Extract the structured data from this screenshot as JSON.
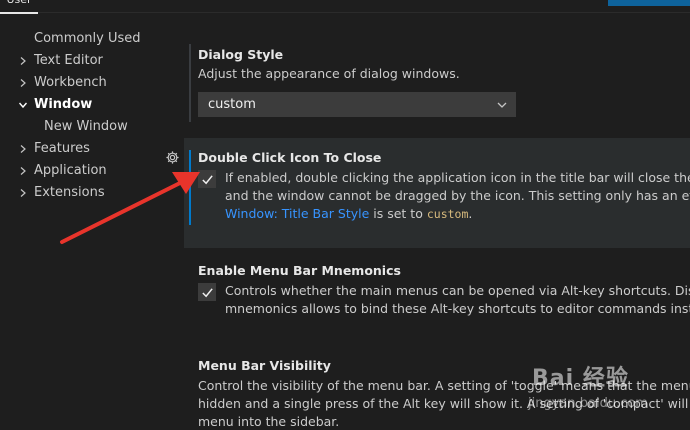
{
  "header": {
    "tab_label": "User"
  },
  "toc": {
    "items": [
      {
        "label": "Commonly Used",
        "expandable": false
      },
      {
        "label": "Text Editor",
        "expandable": true
      },
      {
        "label": "Workbench",
        "expandable": true
      },
      {
        "label": "Window",
        "expandable": true,
        "expanded": true,
        "active": true
      },
      {
        "label": "New Window",
        "expandable": false,
        "child": true
      },
      {
        "label": "Features",
        "expandable": true
      },
      {
        "label": "Application",
        "expandable": true
      },
      {
        "label": "Extensions",
        "expandable": true
      }
    ]
  },
  "settings": {
    "dialog_style": {
      "title": "Dialog Style",
      "description": "Adjust the appearance of dialog windows.",
      "value": "custom"
    },
    "double_click_icon": {
      "title": "Double Click Icon To Close",
      "desc_line1": "If enabled, double clicking the application icon in the title bar will close the window",
      "desc_line2": "and the window cannot be dragged by the icon. This setting only has an effect when",
      "desc_link": "Window: Title Bar Style",
      "desc_mid": " is set to ",
      "desc_code": "custom",
      "desc_end": ".",
      "checked": true
    },
    "menu_mnemonics": {
      "title": "Enable Menu Bar Mnemonics",
      "desc_line1": "Controls whether the main menus can be opened via Alt-key shortcuts. Disabling",
      "desc_line2": "mnemonics allows to bind these Alt-key shortcuts to editor commands instead.",
      "checked": true
    },
    "menu_visibility": {
      "title": "Menu Bar Visibility",
      "desc_line1": "Control the visibility of the menu bar. A setting of 'toggle' means that the menu bar is",
      "desc_line2": "hidden and a single press of the Alt key will show it. A setting of 'compact' will move the",
      "desc_line3": "menu into the sidebar."
    }
  },
  "watermark": {
    "brand": "Bai 经验",
    "url": "jingyan.baidu.com"
  },
  "colors": {
    "background": "#1e1e1e",
    "focused_row": "#2a2d2e",
    "accent": "#007acc",
    "link": "#3794ff",
    "annotation_arrow": "#e8342b"
  }
}
